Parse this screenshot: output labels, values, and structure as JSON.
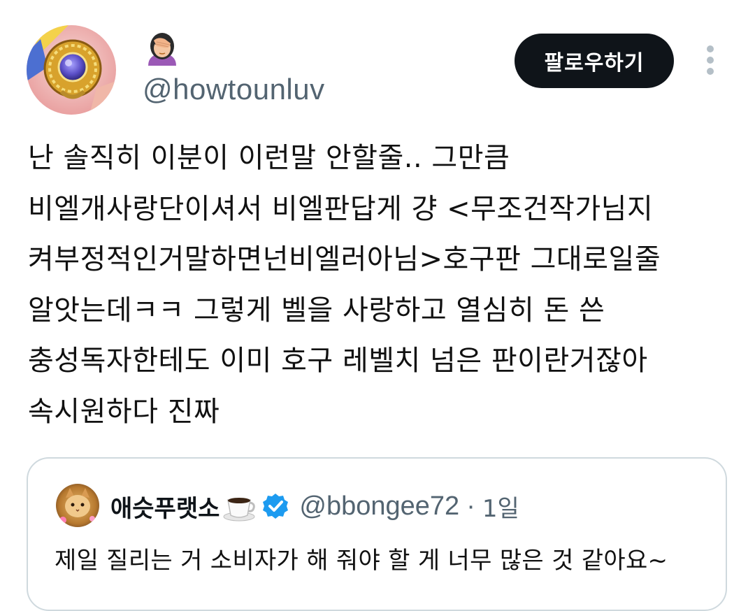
{
  "author": {
    "avatar_icon": "sailor-moon-brooch-icon",
    "display_name_icon": "face-palm-woman-emoji",
    "handle": "@howtounluv",
    "follow_label": "팔로우하기",
    "more_icon": "more-vertical-icon"
  },
  "tweet": {
    "lines": [
      "난 솔직히 이분이 이런말 안할줄.. 그만큼",
      "비엘개사랑단이셔서 비엘판답게 걍 <무조건작가님지",
      "켜부정적인거말하면넌비엘러아님>호구판 그대로일줄",
      "알앗는데ㅋㅋ 그렇게 벨을 사랑하고 열심히 돈 쓴",
      "충성독자한테도 이미 호구 레벨치 넘은 판이란거잖아",
      "속시원하다 진짜"
    ]
  },
  "quoted": {
    "avatar_icon": "cat-photo-avatar",
    "display_name": "애슷푸랫소",
    "name_emoji": "coffee-cup-emoji",
    "verified_icon": "verified-badge-icon",
    "handle": "@bbongee72",
    "separator": "·",
    "time": "1일",
    "text": "제일 질리는 거 소비자가 해 줘야 할 게 너무 많은 것 같아요~"
  },
  "colors": {
    "text_primary": "#0f1419",
    "text_secondary": "#536471",
    "follow_bg": "#0f1419",
    "verified_blue": "#1d9bf0",
    "card_border": "#cfd9de"
  }
}
